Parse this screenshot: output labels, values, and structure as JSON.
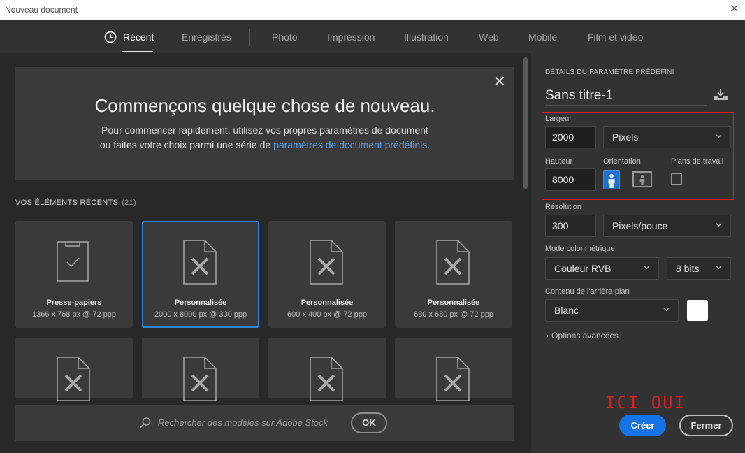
{
  "window": {
    "title": "Nouveau document",
    "close_glyph": "✕"
  },
  "tabs": [
    {
      "label": "Récent",
      "active": true
    },
    {
      "label": "Enregistrés"
    },
    {
      "label": "Photo"
    },
    {
      "label": "Impression"
    },
    {
      "label": "Illustration"
    },
    {
      "label": "Web"
    },
    {
      "label": "Mobile"
    },
    {
      "label": "Film et vidéo"
    }
  ],
  "banner": {
    "heading": "Commençons quelque chose de nouveau.",
    "line1": "Pour commencer rapidement, utilisez vos propres paramètres de document",
    "line2_prefix": "ou faites votre choix parmi une série de ",
    "line2_link": "paramètres de document prédéfinis",
    "line2_suffix": ".",
    "close_glyph": "✕"
  },
  "recent": {
    "title": "VOS ÉLÉMENTS RÉCENTS",
    "count": "(21)",
    "items": [
      {
        "name": "Presse-papiers",
        "size": "1366 x 768 px @ 72 ppp",
        "icon": "clipboard-icon"
      },
      {
        "name": "Personnalisée",
        "size": "2000 x 8000 px @ 300 ppp",
        "icon": "custom-document-icon",
        "selected": true
      },
      {
        "name": "Personnalisée",
        "size": "600 x 400 px @ 72 ppp",
        "icon": "custom-document-icon"
      },
      {
        "name": "Personnalisée",
        "size": "680 x 680 px @ 72 ppp",
        "icon": "custom-document-icon"
      }
    ]
  },
  "search": {
    "placeholder": "Rechercher des modèles sur Adobe Stock",
    "ok_label": "OK"
  },
  "preset": {
    "section_title": "DÉTAILS DU PARAMÈTRE PRÉDÉFINI",
    "name": "Sans titre-1",
    "width_label": "Largeur",
    "width_value": "2000",
    "width_unit": "Pixels",
    "height_label": "Hauteur",
    "height_value": "8000",
    "orientation_label": "Orientation",
    "artboards_label": "Plans de travail",
    "resolution_label": "Résolution",
    "resolution_value": "300",
    "resolution_unit": "Pixels/pouce",
    "color_mode_label": "Mode colorimétrique",
    "color_mode_value": "Couleur RVB",
    "bit_depth_value": "8 bits",
    "background_label": "Contenu de l'arrière-plan",
    "background_value": "Blanc",
    "background_swatch_color": "#ffffff",
    "advanced_label": "Options avancées"
  },
  "annotation": "ICI OUI",
  "actions": {
    "create_label": "Créer",
    "close_label": "Fermer"
  },
  "colors": {
    "accent": "#1473e6",
    "highlight_box": "#d92323",
    "selection": "#2f86e0"
  }
}
